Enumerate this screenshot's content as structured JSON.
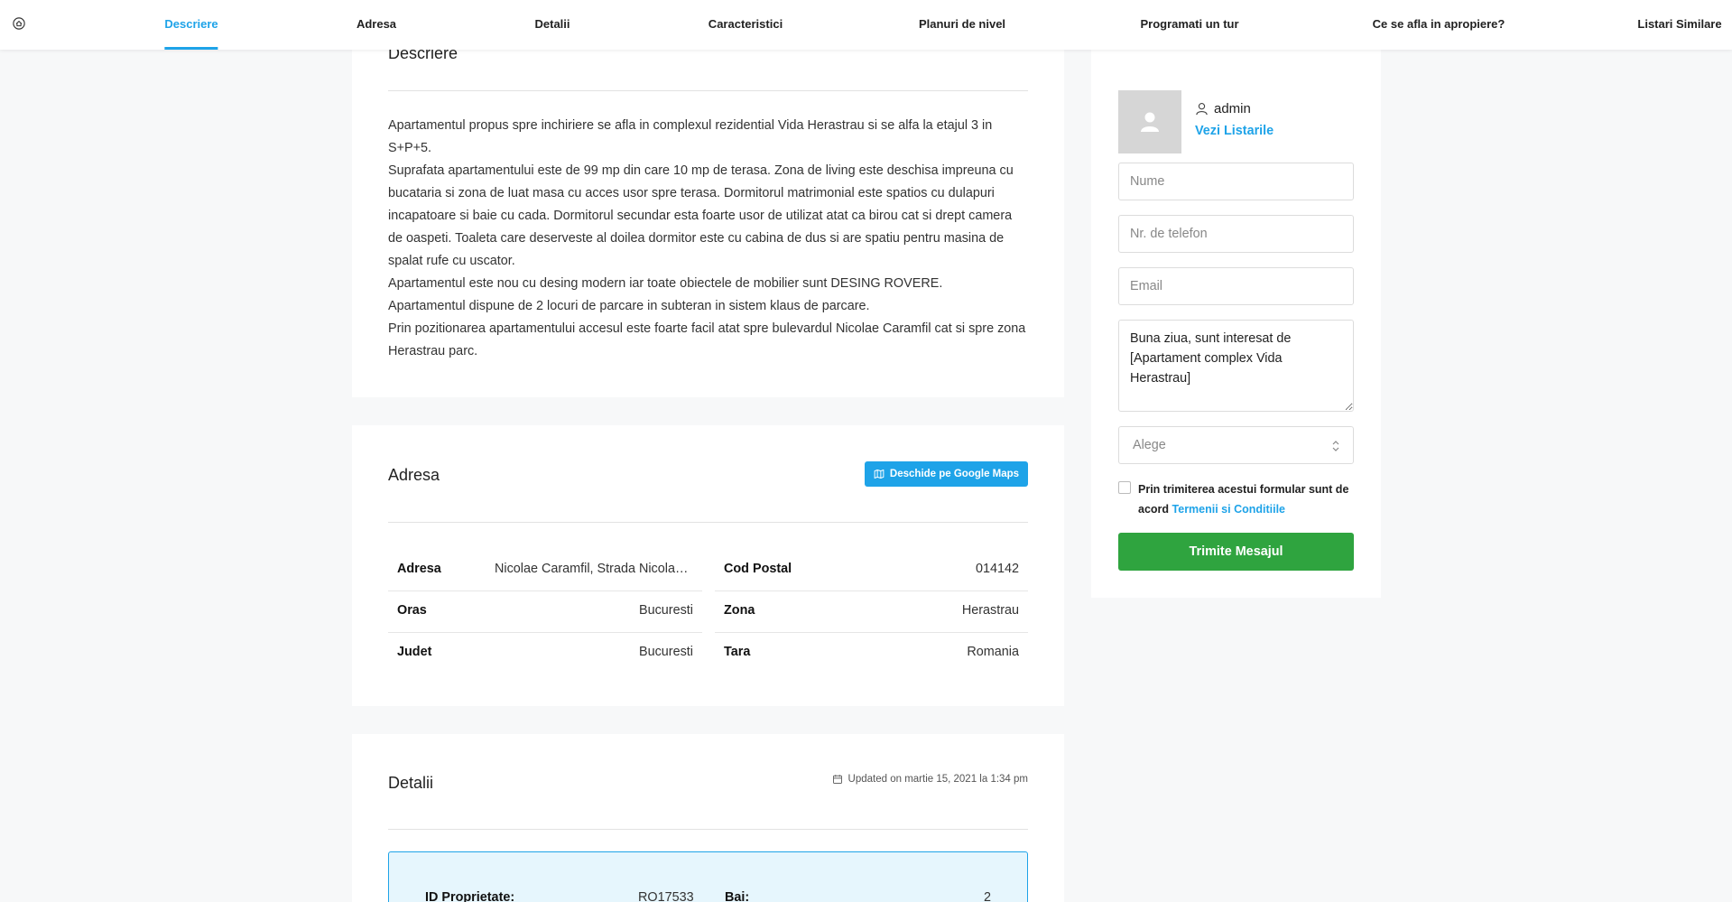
{
  "nav": {
    "items": [
      {
        "label": "Descriere",
        "active": true
      },
      {
        "label": "Adresa"
      },
      {
        "label": "Detalii"
      },
      {
        "label": "Caracteristici"
      },
      {
        "label": "Planuri de nivel"
      },
      {
        "label": "Programati un tur"
      },
      {
        "label": "Ce se afla in apropiere?"
      },
      {
        "label": "Listari Similare"
      }
    ]
  },
  "description": {
    "title": "Descriere",
    "paragraphs": [
      "Apartamentul propus spre inchiriere se afla in complexul rezidential Vida Herastrau si se alfa la etajul 3 in S+P+5.",
      "Suprafata apartamentului este de 99 mp din care 10 mp de terasa. Zona de living este deschisa impreuna cu bucataria si zona de luat masa cu acces usor spre terasa. Dormitorul matrimonial este spatios cu dulapuri incapatoare si baie cu cada. Dormitorul secundar esta foarte usor de utilizat atat ca birou cat si drept camera de oaspeti. Toaleta care deserveste al doilea dormitor este cu cabina de dus si are spatiu pentru masina de spalat rufe cu uscator.",
      "Apartamentul este nou cu desing modern iar toate obiectele de mobilier sunt DESING ROVERE.",
      "Apartamentul dispune de 2 locuri de parcare in subteran in sistem klaus de parcare.",
      "Prin pozitionarea apartamentului accesul este foarte facil atat spre bulevardul Nicolae Caramfil cat si spre zona Herastrau parc."
    ]
  },
  "address": {
    "title": "Adresa",
    "maps_button": "Deschide pe Google Maps",
    "left": [
      {
        "label": "Adresa",
        "value": "Nicolae Caramfil, Strada Nicolae Caramfil"
      },
      {
        "label": "Oras",
        "value": "Bucuresti"
      },
      {
        "label": "Judet",
        "value": "Bucuresti"
      }
    ],
    "right": [
      {
        "label": "Cod Postal",
        "value": "014142"
      },
      {
        "label": "Zona",
        "value": "Herastrau"
      },
      {
        "label": "Tara",
        "value": "Romania"
      }
    ]
  },
  "details": {
    "title": "Detalii",
    "updated": "Updated on martie 15, 2021 la 1:34 pm",
    "rows": [
      {
        "label": "ID Proprietate:",
        "value": "RO17533"
      },
      {
        "label": "Bai:",
        "value": "2"
      }
    ]
  },
  "sidebar": {
    "agent_name": "admin",
    "agent_link": "Vezi Listarile",
    "name_placeholder": "Nume",
    "phone_placeholder": "Nr. de telefon",
    "email_placeholder": "Email",
    "message_value": "Buna ziua, sunt interesat de [Apartament complex Vida Herastrau]",
    "select_value": "Alege",
    "consent_text": "Prin trimiterea acestui formular sunt de acord",
    "consent_link": "Termenii si Conditiile",
    "submit_label": "Trimite Mesajul"
  },
  "colors": {
    "accent": "#1ea3e8",
    "submit": "#2fa43f",
    "page_bg": "#f7f8f9"
  }
}
